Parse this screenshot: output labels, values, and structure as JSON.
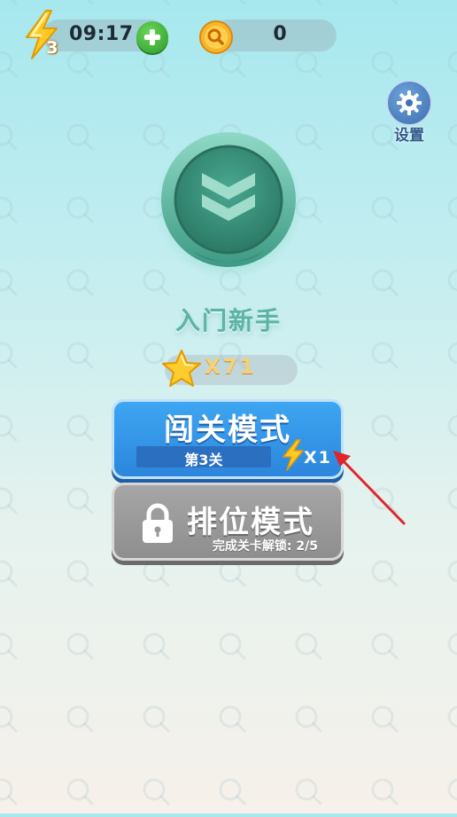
{
  "top_bar": {
    "energy": {
      "count": "3",
      "timer": "09:17",
      "icon": "lightning-bolt-icon",
      "add_icon": "plus-icon"
    },
    "coins": {
      "value": "0",
      "icon": "coin-magnifier-icon"
    }
  },
  "settings": {
    "label": "设置",
    "icon": "gear-icon"
  },
  "rank": {
    "name": "入门新手",
    "badge_icon": "chevron-badge-icon"
  },
  "stars": {
    "text": "X71",
    "icon": "star-icon"
  },
  "level_mode": {
    "title": "闯关模式",
    "subtitle": "第3关",
    "cost": "X1",
    "cost_icon": "lightning-bolt-icon"
  },
  "ranked_mode": {
    "title": "排位模式",
    "unlock_text": "完成关卡解锁: 2/5",
    "icon": "lock-icon",
    "locked": true
  },
  "annotation": {
    "icon": "red-arrow"
  },
  "colors": {
    "level_button": "#3ea6f2",
    "ranked_button_locked": "#9a9a9a",
    "rank_name": "#5db3a6",
    "annotation_arrow": "#e0252b"
  }
}
